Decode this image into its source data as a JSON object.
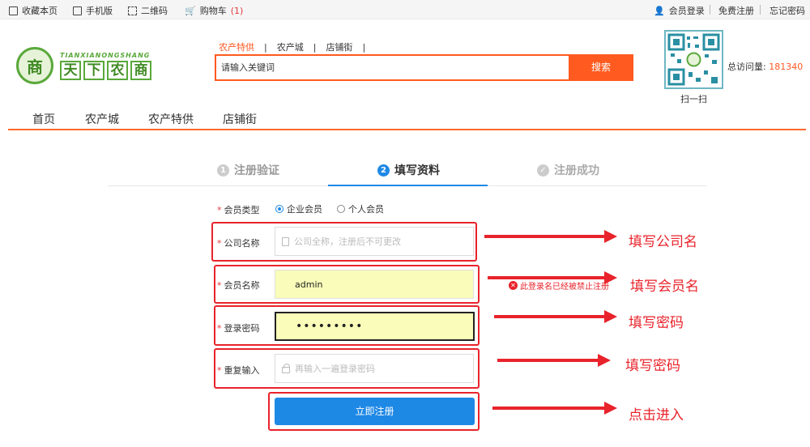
{
  "topbar": {
    "bookmark": "收藏本页",
    "mobile": "手机版",
    "qrcode": "二维码",
    "cart": "购物车",
    "cart_count": "(1)",
    "login": "会员登录",
    "register": "免费注册",
    "forgot": "忘记密码"
  },
  "logo": {
    "en": "TIANXIANONGSHANG",
    "cn": [
      "天",
      "下",
      "农",
      "商"
    ],
    "seal": "商"
  },
  "search": {
    "tabs": [
      "农产特供",
      "农产城",
      "店铺街"
    ],
    "placeholder": "请输入关键词",
    "button": "搜索"
  },
  "qr": {
    "label": "扫一扫"
  },
  "visits": {
    "label": "总访问量:",
    "value": "181340"
  },
  "nav": {
    "items": [
      "首页",
      "农产城",
      "农产特供",
      "店铺街"
    ]
  },
  "steps": [
    {
      "num": "1",
      "label": "注册验证",
      "state": "done"
    },
    {
      "num": "2",
      "label": "填写资料",
      "state": "active"
    },
    {
      "num": "✓",
      "label": "注册成功",
      "state": "pending"
    }
  ],
  "form": {
    "member_type_label": "会员类型",
    "member_type_options": [
      "企业会员",
      "个人会员"
    ],
    "member_type_selected": "企业会员",
    "company_label": "公司名称",
    "company_placeholder": "公司全称，注册后不可更改",
    "member_name_label": "会员名称",
    "member_name_value": "admin",
    "member_name_error": "此登录名已经被禁止注册",
    "password_label": "登录密码",
    "password_value": "•••••••••",
    "repeat_label": "重复输入",
    "repeat_placeholder": "再输入一遍登录密码",
    "submit": "立即注册"
  },
  "annotations": [
    "填写公司名",
    "填写会员名",
    "填写密码",
    "填写密码",
    "点击进入"
  ],
  "colors": {
    "accent": "#ff5a1f",
    "primary": "#1e88e5",
    "annotation": "#e8232b"
  }
}
